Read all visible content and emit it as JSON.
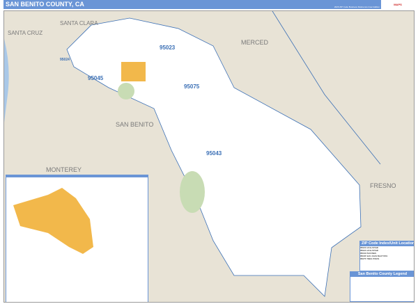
{
  "header": {
    "title": "SAN BENITO COUNTY, CA",
    "edition": "2026 ZIP Code Business Reference Inset Edition",
    "logo": "MarketMAPS"
  },
  "map": {
    "places": [
      "SANTA CRUZ",
      "SANTA CLARA",
      "MERCED",
      "SAN BENITO",
      "MONTEREY",
      "FRESNO"
    ],
    "zips": [
      "95023",
      "95024",
      "95045",
      "95075",
      "95043"
    ],
    "colors": {
      "county": "#ffffff",
      "surround": "#e8e3d6",
      "water": "#a9c8e8",
      "urban": "#f2b84b",
      "park": "#c8dcb4",
      "zip_label": "#3a6fb5"
    }
  },
  "index": {
    "title": "ZIP Code Index/Unit Location",
    "rows": [
      [
        "95023",
        "HOLLISTER"
      ],
      [
        "95024",
        "HOLLISTER"
      ],
      [
        "95043",
        "PAICINES"
      ],
      [
        "95045",
        "SAN JUAN BAUTISTA"
      ],
      [
        "95075",
        "TRES PINOS"
      ]
    ]
  },
  "legend": {
    "title": "San Benito County Legend"
  }
}
